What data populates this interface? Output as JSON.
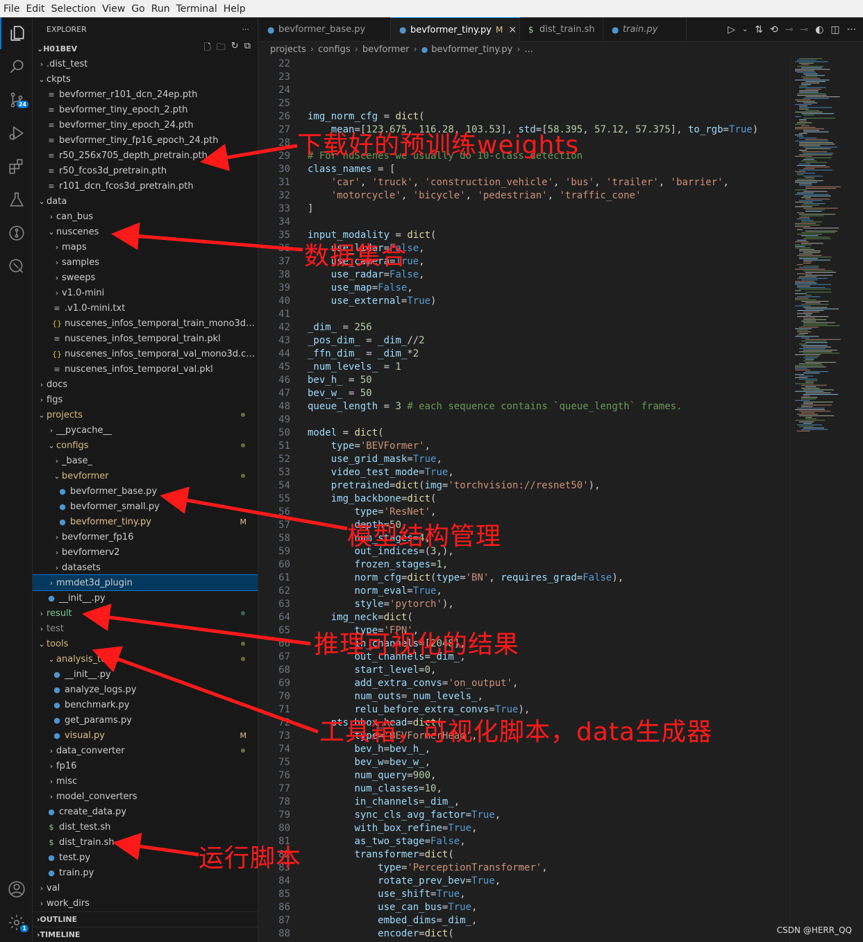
{
  "menu": [
    "File",
    "Edit",
    "Selection",
    "View",
    "Go",
    "Run",
    "Terminal",
    "Help"
  ],
  "activity_bar": {
    "items": [
      "files-icon",
      "search-icon",
      "source-control-icon",
      "run-debug-icon",
      "extensions-icon",
      "testing-icon",
      "git-graph-icon",
      "remote-explorer-icon"
    ],
    "scm_badge": "24",
    "settings_badge": "1"
  },
  "sidebar": {
    "title": "EXPLORER",
    "more": "···",
    "root": "H01BEV",
    "outline": "OUTLINE",
    "timeline": "TIMELINE"
  },
  "tree": [
    {
      "label": ".dist_test",
      "type": "folder",
      "open": false,
      "depth": 1
    },
    {
      "label": "ckpts",
      "type": "folder",
      "open": true,
      "depth": 1
    },
    {
      "label": "bevformer_r101_dcn_24ep.pth",
      "type": "file",
      "icon": "≡",
      "depth": 2
    },
    {
      "label": "bevformer_tiny_epoch_2.pth",
      "type": "file",
      "icon": "≡",
      "depth": 2
    },
    {
      "label": "bevformer_tiny_epoch_24.pth",
      "type": "file",
      "icon": "≡",
      "depth": 2
    },
    {
      "label": "bevformer_tiny_fp16_epoch_24.pth",
      "type": "file",
      "icon": "≡",
      "depth": 2
    },
    {
      "label": "r50_256x705_depth_pretrain.pth",
      "type": "file",
      "icon": "≡",
      "depth": 2
    },
    {
      "label": "r50_fcos3d_pretrain.pth",
      "type": "file",
      "icon": "≡",
      "depth": 2
    },
    {
      "label": "r101_dcn_fcos3d_pretrain.pth",
      "type": "file",
      "icon": "≡",
      "depth": 2
    },
    {
      "label": "data",
      "type": "folder",
      "open": true,
      "depth": 1
    },
    {
      "label": "can_bus",
      "type": "folder",
      "open": false,
      "depth": 2
    },
    {
      "label": "nuscenes",
      "type": "folder",
      "open": true,
      "depth": 2
    },
    {
      "label": "maps",
      "type": "folder",
      "open": false,
      "depth": 3
    },
    {
      "label": "samples",
      "type": "folder",
      "open": false,
      "depth": 3
    },
    {
      "label": "sweeps",
      "type": "folder",
      "open": false,
      "depth": 3
    },
    {
      "label": "v1.0-mini",
      "type": "folder",
      "open": false,
      "depth": 3
    },
    {
      "label": ".v1.0-mini.txt",
      "type": "file",
      "icon": "≡",
      "depth": 3
    },
    {
      "label": "nuscenes_infos_temporal_train_mono3d.co...",
      "type": "file",
      "icon": "{}",
      "depth": 3
    },
    {
      "label": "nuscenes_infos_temporal_train.pkl",
      "type": "file",
      "icon": "≡",
      "depth": 3
    },
    {
      "label": "nuscenes_infos_temporal_val_mono3d.coco...",
      "type": "file",
      "icon": "{}",
      "depth": 3
    },
    {
      "label": "nuscenes_infos_temporal_val.pkl",
      "type": "file",
      "icon": "≡",
      "depth": 3
    },
    {
      "label": "docs",
      "type": "folder",
      "open": false,
      "depth": 1
    },
    {
      "label": "figs",
      "type": "folder",
      "open": false,
      "depth": 1
    },
    {
      "label": "projects",
      "type": "folder",
      "open": true,
      "depth": 1,
      "status": "yel",
      "dot": true
    },
    {
      "label": "__pycache__",
      "type": "folder",
      "open": false,
      "depth": 2
    },
    {
      "label": "configs",
      "type": "folder",
      "open": true,
      "depth": 2,
      "status": "yel",
      "dot": true
    },
    {
      "label": "_base_",
      "type": "folder",
      "open": false,
      "depth": 3
    },
    {
      "label": "bevformer",
      "type": "folder",
      "open": true,
      "depth": 3,
      "status": "yel",
      "dot": true
    },
    {
      "label": "bevformer_base.py",
      "type": "file",
      "icon": "py",
      "depth": 4
    },
    {
      "label": "bevformer_small.py",
      "type": "file",
      "icon": "py",
      "depth": 4
    },
    {
      "label": "bevformer_tiny.py",
      "type": "file",
      "icon": "py",
      "depth": 4,
      "status": "mod",
      "deco": "M"
    },
    {
      "label": "bevformer_fp16",
      "type": "folder",
      "open": false,
      "depth": 3
    },
    {
      "label": "bevformerv2",
      "type": "folder",
      "open": false,
      "depth": 3
    },
    {
      "label": "datasets",
      "type": "folder",
      "open": false,
      "depth": 3
    },
    {
      "label": "mmdet3d_plugin",
      "type": "folder",
      "open": false,
      "depth": 2,
      "selected": true
    },
    {
      "label": "__init__.py",
      "type": "file",
      "icon": "py",
      "depth": 2
    },
    {
      "label": "result",
      "type": "folder",
      "open": false,
      "depth": 1,
      "status": "grn",
      "dot": true,
      "dotcolor": "#3d6b4a"
    },
    {
      "label": "test",
      "type": "folder",
      "open": false,
      "depth": 1,
      "dim": true
    },
    {
      "label": "tools",
      "type": "folder",
      "open": true,
      "depth": 1,
      "status": "yel",
      "dot": true
    },
    {
      "label": "analysis_tools",
      "type": "folder",
      "open": true,
      "depth": 2,
      "status": "yel",
      "dot": true
    },
    {
      "label": "__init__.py",
      "type": "file",
      "icon": "py",
      "depth": 3
    },
    {
      "label": "analyze_logs.py",
      "type": "file",
      "icon": "py",
      "depth": 3
    },
    {
      "label": "benchmark.py",
      "type": "file",
      "icon": "py",
      "depth": 3
    },
    {
      "label": "get_params.py",
      "type": "file",
      "icon": "py",
      "depth": 3
    },
    {
      "label": "visual.py",
      "type": "file",
      "icon": "py",
      "depth": 3,
      "status": "mod",
      "deco": "M"
    },
    {
      "label": "data_converter",
      "type": "folder",
      "open": false,
      "depth": 2,
      "dot": true
    },
    {
      "label": "fp16",
      "type": "folder",
      "open": false,
      "depth": 2
    },
    {
      "label": "misc",
      "type": "folder",
      "open": false,
      "depth": 2
    },
    {
      "label": "model_converters",
      "type": "folder",
      "open": false,
      "depth": 2
    },
    {
      "label": "create_data.py",
      "type": "file",
      "icon": "py",
      "depth": 2
    },
    {
      "label": "dist_test.sh",
      "type": "file",
      "icon": "$",
      "depth": 2
    },
    {
      "label": "dist_train.sh",
      "type": "file",
      "icon": "$",
      "depth": 2
    },
    {
      "label": "test.py",
      "type": "file",
      "icon": "py",
      "depth": 2
    },
    {
      "label": "train.py",
      "type": "file",
      "icon": "py",
      "depth": 2
    },
    {
      "label": "val",
      "type": "folder",
      "open": false,
      "depth": 1
    },
    {
      "label": "work_dirs",
      "type": "folder",
      "open": false,
      "depth": 1
    }
  ],
  "tabs": [
    {
      "label": "bevformer_base.py",
      "icon": "py",
      "active": false
    },
    {
      "label": "bevformer_tiny.py",
      "icon": "py",
      "active": true,
      "mod": "M",
      "close": "×"
    },
    {
      "label": "dist_train.sh",
      "icon": "$",
      "active": false
    },
    {
      "label": "train.py",
      "icon": "py",
      "active": false,
      "italic": true
    }
  ],
  "breadcrumb": [
    "projects",
    "configs",
    "bevformer",
    "bevformer_tiny.py",
    "..."
  ],
  "code_lines": [
    {
      "n": "22",
      "t": ""
    },
    {
      "n": "23",
      "t": ""
    },
    {
      "n": "24",
      "t": ""
    },
    {
      "n": "25",
      "t": ""
    },
    {
      "n": "26",
      "t": "img_norm_cfg = dict("
    },
    {
      "n": "27",
      "t": "    mean=[123.675, 116.28, 103.53], std=[58.395, 57.12, 57.375], to_rgb=True)"
    },
    {
      "n": "28",
      "t": ""
    },
    {
      "n": "29",
      "t": "# For nuScenes we usually do 10-class detection"
    },
    {
      "n": "30",
      "t": "class_names = ["
    },
    {
      "n": "31",
      "t": "    'car', 'truck', 'construction_vehicle', 'bus', 'trailer', 'barrier',"
    },
    {
      "n": "32",
      "t": "    'motorcycle', 'bicycle', 'pedestrian', 'traffic_cone'"
    },
    {
      "n": "33",
      "t": "]"
    },
    {
      "n": "34",
      "t": ""
    },
    {
      "n": "35",
      "t": "input_modality = dict("
    },
    {
      "n": "36",
      "t": "    use_lidar=False,"
    },
    {
      "n": "37",
      "t": "    use_camera=True,"
    },
    {
      "n": "38",
      "t": "    use_radar=False,"
    },
    {
      "n": "39",
      "t": "    use_map=False,"
    },
    {
      "n": "40",
      "t": "    use_external=True)"
    },
    {
      "n": "41",
      "t": ""
    },
    {
      "n": "42",
      "t": "_dim_ = 256"
    },
    {
      "n": "43",
      "t": "_pos_dim_ = _dim_//2"
    },
    {
      "n": "44",
      "t": "_ffn_dim_ = _dim_*2"
    },
    {
      "n": "45",
      "t": "_num_levels_ = 1"
    },
    {
      "n": "46",
      "t": "bev_h_ = 50"
    },
    {
      "n": "47",
      "t": "bev_w_ = 50"
    },
    {
      "n": "48",
      "t": "queue_length = 3 # each sequence contains `queue_length` frames."
    },
    {
      "n": "49",
      "t": ""
    },
    {
      "n": "50",
      "t": "model = dict("
    },
    {
      "n": "51",
      "t": "    type='BEVFormer',"
    },
    {
      "n": "52",
      "t": "    use_grid_mask=True,"
    },
    {
      "n": "53",
      "t": "    video_test_mode=True,"
    },
    {
      "n": "54",
      "t": "    pretrained=dict(img='torchvision://resnet50'),"
    },
    {
      "n": "55",
      "t": "    img_backbone=dict("
    },
    {
      "n": "56",
      "t": "        type='ResNet',"
    },
    {
      "n": "57",
      "t": "        depth=50,"
    },
    {
      "n": "58",
      "t": "        num_stages=4,"
    },
    {
      "n": "59",
      "t": "        out_indices=(3,),"
    },
    {
      "n": "60",
      "t": "        frozen_stages=1,"
    },
    {
      "n": "61",
      "t": "        norm_cfg=dict(type='BN', requires_grad=False),"
    },
    {
      "n": "62",
      "t": "        norm_eval=True,"
    },
    {
      "n": "63",
      "t": "        style='pytorch'),"
    },
    {
      "n": "64",
      "t": "    img_neck=dict("
    },
    {
      "n": "65",
      "t": "        type='FPN',"
    },
    {
      "n": "66",
      "t": "        in_channels=[2048],"
    },
    {
      "n": "67",
      "t": "        out_channels=_dim_,"
    },
    {
      "n": "68",
      "t": "        start_level=0,"
    },
    {
      "n": "69",
      "t": "        add_extra_convs='on_output',"
    },
    {
      "n": "70",
      "t": "        num_outs=_num_levels_,"
    },
    {
      "n": "71",
      "t": "        relu_before_extra_convs=True),"
    },
    {
      "n": "72",
      "t": "    pts_bbox_head=dict("
    },
    {
      "n": "73",
      "t": "        type='BEVFormerHead',"
    },
    {
      "n": "74",
      "t": "        bev_h=bev_h_,"
    },
    {
      "n": "75",
      "t": "        bev_w=bev_w_,"
    },
    {
      "n": "76",
      "t": "        num_query=900,"
    },
    {
      "n": "77",
      "t": "        num_classes=10,"
    },
    {
      "n": "78",
      "t": "        in_channels=_dim_,"
    },
    {
      "n": "79",
      "t": "        sync_cls_avg_factor=True,"
    },
    {
      "n": "80",
      "t": "        with_box_refine=True,"
    },
    {
      "n": "81",
      "t": "        as_two_stage=False,"
    },
    {
      "n": "82",
      "t": "        transformer=dict("
    },
    {
      "n": "83",
      "t": "            type='PerceptionTransformer',"
    },
    {
      "n": "84",
      "t": "            rotate_prev_bev=True,"
    },
    {
      "n": "85",
      "t": "            use_shift=True,"
    },
    {
      "n": "86",
      "t": "            use_can_bus=True,"
    },
    {
      "n": "87",
      "t": "            embed_dims=_dim_,"
    },
    {
      "n": "88",
      "t": "            encoder=dict("
    }
  ],
  "annotations": [
    {
      "text": "下载好的预训练weights"
    },
    {
      "text": "数据集合"
    },
    {
      "text": "模型结构管理"
    },
    {
      "text": "推理可视化的结果"
    },
    {
      "text": "工具箱，可视化脚本，data生成器"
    },
    {
      "text": "运行脚本"
    }
  ],
  "watermark": "CSDN @HERR_QQ",
  "colors": {
    "accent": "#0078d4",
    "annotation": "#ff1a1a",
    "modified": "#e2c08d"
  }
}
